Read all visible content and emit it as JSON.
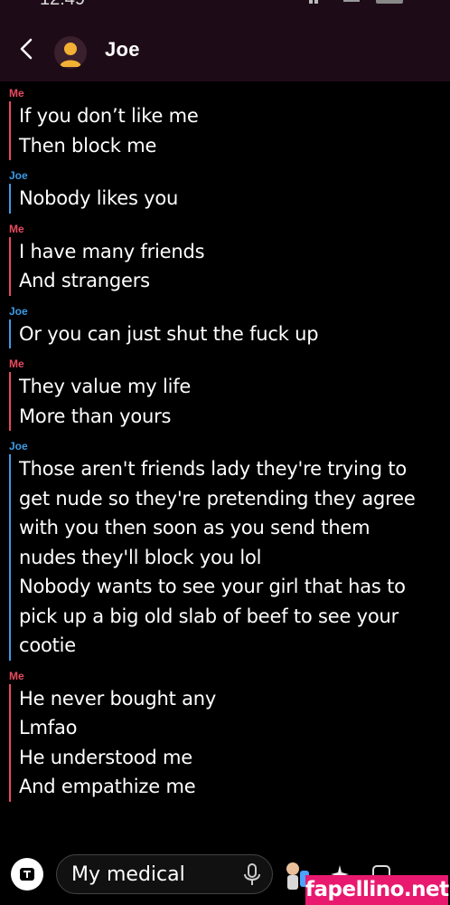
{
  "status_bar": {
    "time": "12:49"
  },
  "header": {
    "title": "Joe",
    "back_icon": "chevron-left-icon",
    "avatar_icon": "avatar-silhouette"
  },
  "messages": [
    {
      "sender": "Me",
      "who": "me",
      "lines": [
        "If you don’t like me",
        "Then block me"
      ]
    },
    {
      "sender": "Joe",
      "who": "joe",
      "lines": [
        "Nobody likes you"
      ]
    },
    {
      "sender": "Me",
      "who": "me",
      "lines": [
        "I have many friends",
        "And strangers"
      ]
    },
    {
      "sender": "Joe",
      "who": "joe",
      "lines": [
        "Or you can just shut the fuck up"
      ]
    },
    {
      "sender": "Me",
      "who": "me",
      "lines": [
        "They value my life",
        "More than yours"
      ]
    },
    {
      "sender": "Joe",
      "who": "joe",
      "lines": [
        "Those aren't friends lady they're trying to",
        "get nude so they're pretending they agree",
        "with you then soon as you send them",
        "nudes they'll block you lol",
        "Nobody wants to see your girl that has to",
        "pick up a big old slab of beef to see your",
        "cootie"
      ]
    },
    {
      "sender": "Me",
      "who": "me",
      "lines": [
        "He never bought any",
        "Lmfao",
        "He understood me",
        "And empathize me"
      ]
    }
  ],
  "composer": {
    "input_value": "My medical",
    "camera_icon": "camera-icon",
    "mic_icon": "microphone-icon",
    "bitmoji_icon": "bitmoji-icon",
    "sparkle_icon": "sparkle-icon",
    "sticker_icon": "sticker-icon"
  },
  "watermark": "fapellino.net",
  "colors": {
    "me": "#e84a5f",
    "joe": "#3b9be8",
    "header_bg": "#1e0b18",
    "watermark_bg": "#e8196e"
  }
}
